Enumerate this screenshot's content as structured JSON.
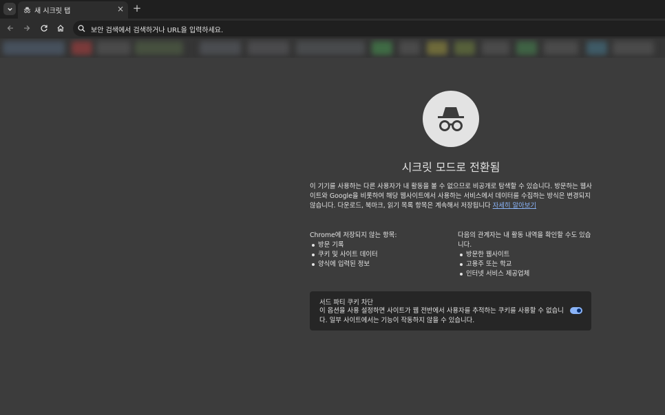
{
  "tab": {
    "title": "새 시크릿 탭",
    "close_glyph": "×",
    "new_tab_glyph": "+"
  },
  "omnibox": {
    "placeholder": "보안 검색에서 검색하거나 URL을 입력하세요."
  },
  "main": {
    "heading": "시크릿 모드로 전환됨",
    "description": "이 기기를 사용하는 다른 사용자가 내 활동을 볼 수 없으므로 비공개로 탐색할 수 있습니다. 방문하는 웹사이트와 Google을 비롯하여 해당 웹사이트에서 사용하는 서비스에서 데이터를 수집하는 방식은 변경되지 않습니다. 다운로드, 북마크, 읽기 목록 항목은 계속해서 저장됩니다",
    "learn_more": "자세히 알아보기",
    "not_saved": {
      "title": "Chrome에 저장되지 않는 항목:",
      "items": [
        "방문 기록",
        "쿠키 및 사이트 데이터",
        "양식에 입력된 정보"
      ]
    },
    "may_be_visible": {
      "title": "다음의 관계자는 내 활동 내역을 확인할 수도 있습니다.",
      "items": [
        "방문한 웹사이트",
        "고용주 또는 학교",
        "인터넷 서비스 제공업체"
      ]
    },
    "cookie_card": {
      "title": "서드 파티 쿠키 차단",
      "description": "이 옵션을 사용 설정하면 사이트가 웹 전반에서 사용자를 추적하는 쿠키를 사용할 수 없습니다. 일부 사이트에서는 기능이 작동하지 않을 수 있습니다.",
      "toggle_on": true
    }
  },
  "icons": {
    "tab_search": "chevron-down-icon",
    "favicon": "incognito-icon",
    "back": "arrow-left-icon",
    "forward": "arrow-right-icon",
    "reload": "reload-icon",
    "home": "home-icon",
    "omnibox": "search-icon",
    "hero": "incognito-icon"
  },
  "colors": {
    "page_bg": "#3c3c3c",
    "tabstrip_bg": "#1f1f1f",
    "toolbar_bg": "#2d2d2d",
    "card_bg": "#262626",
    "link": "#8ab4f8",
    "text": "#e3e3e3"
  }
}
